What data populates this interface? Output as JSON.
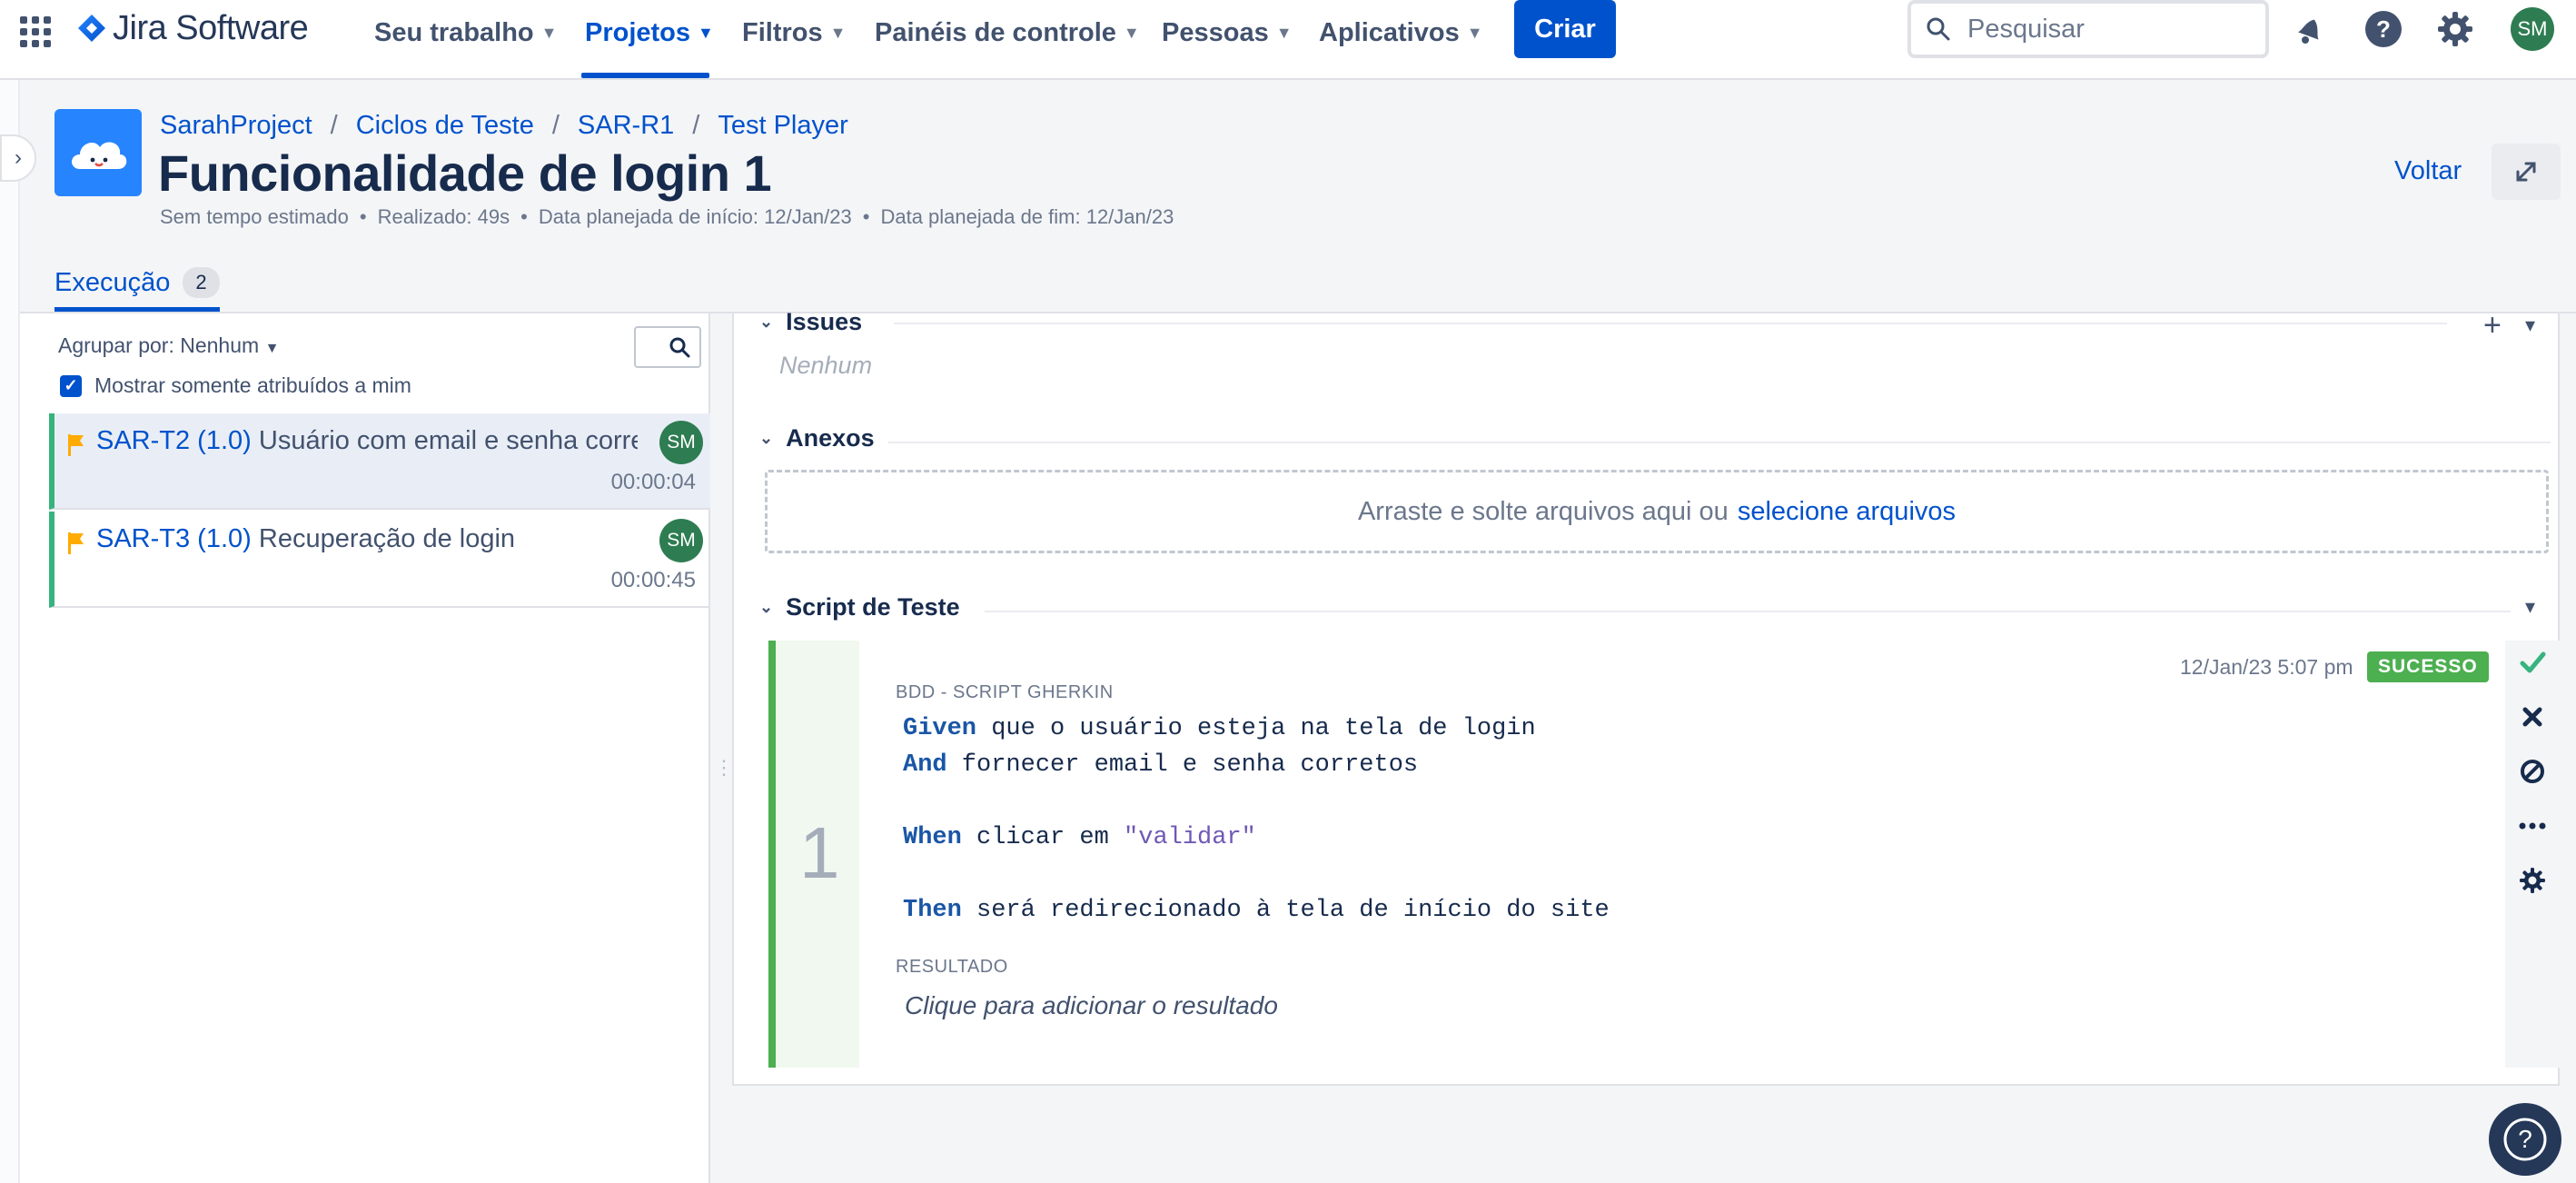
{
  "app": {
    "name": "Jira Software"
  },
  "nav": {
    "items": [
      {
        "label": "Seu trabalho"
      },
      {
        "label": "Projetos"
      },
      {
        "label": "Filtros"
      },
      {
        "label": "Painéis de controle"
      },
      {
        "label": "Pessoas"
      },
      {
        "label": "Aplicativos"
      }
    ],
    "create_label": "Criar",
    "search_placeholder": "Pesquisar",
    "user_initials": "SM"
  },
  "breadcrumbs": [
    "SarahProject",
    "Ciclos de Teste",
    "SAR-R1",
    "Test Player"
  ],
  "page": {
    "title": "Funcionalidade de login 1",
    "meta": [
      "Sem tempo estimado",
      "Realizado: 49s",
      "Data planejada de início: 12/Jan/23",
      "Data planejada de fim: 12/Jan/23"
    ],
    "back_label": "Voltar"
  },
  "tabs": [
    {
      "label": "Execução",
      "count": "2"
    }
  ],
  "left_panel": {
    "group_by": "Agrupar por: Nenhum",
    "only_mine": "Mostrar somente atribuídos a mim",
    "only_mine_checked": true,
    "items": [
      {
        "key": "SAR-T2 (1.0)",
        "name": "Usuário com email e senha corretos",
        "assignee": "SM",
        "time": "00:00:04",
        "selected": true
      },
      {
        "key": "SAR-T3 (1.0)",
        "name": "Recuperação de login",
        "assignee": "SM",
        "time": "00:00:45",
        "selected": false
      }
    ]
  },
  "sections": {
    "issues": {
      "title": "Issues",
      "value": "Nenhum"
    },
    "attachments": {
      "title": "Anexos",
      "drop_text": "Arraste e solte arquivos aqui ou",
      "drop_link": "selecione arquivos"
    },
    "script": {
      "title": "Script de Teste"
    }
  },
  "step": {
    "number": "1",
    "type": "BDD - SCRIPT GHERKIN",
    "date": "12/Jan/23 5:07 pm",
    "status": "SUCESSO",
    "status_color": "#4caf50",
    "lines": [
      {
        "keyword": "Given",
        "text": " que o usuário esteja na tela de login"
      },
      {
        "keyword": "And",
        "text": " fornecer email e senha corretos"
      },
      {
        "keyword": "When",
        "text": " clicar em ",
        "string": "\"validar\""
      },
      {
        "keyword": "Then",
        "text": " será redirecionado à tela de início do site"
      }
    ],
    "result_label": "RESULTADO",
    "result_placeholder": "Clique para adicionar o resultado"
  },
  "colors": {
    "brand": "#0052cc",
    "success": "#4caf50",
    "avatar": "#2e7d52"
  }
}
